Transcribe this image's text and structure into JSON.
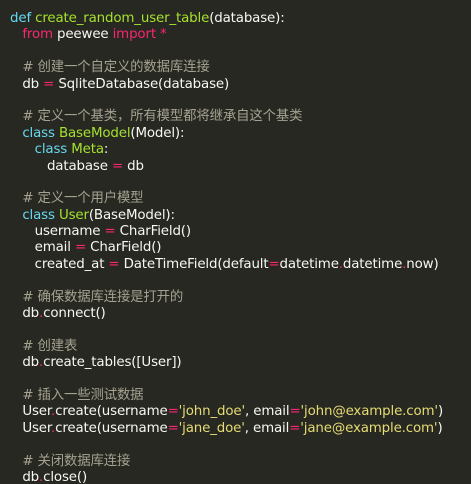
{
  "colors": {
    "background": "#272822",
    "default": "#f8f8f2",
    "keyword": "#66d9ef",
    "keyword_import": "#f92672",
    "function": "#a6e22e",
    "operator": "#f92672",
    "string": "#e6db74",
    "comment": "#a5a290"
  },
  "lines": [
    [
      [
        "def",
        "keyword"
      ],
      [
        " ",
        "default"
      ],
      [
        "create_random_user_table",
        "function"
      ],
      [
        "(database):",
        "default"
      ]
    ],
    [
      [
        "   ",
        "default"
      ],
      [
        "from",
        "keyword_import"
      ],
      [
        " peewee ",
        "default"
      ],
      [
        "import",
        "keyword_import"
      ],
      [
        " ",
        "default"
      ],
      [
        "*",
        "operator"
      ]
    ],
    [],
    [
      [
        "   # 创建一个自定义的数据库连接",
        "comment"
      ]
    ],
    [
      [
        "   db ",
        "default"
      ],
      [
        "=",
        "operator"
      ],
      [
        " SqliteDatabase(database)",
        "default"
      ]
    ],
    [],
    [
      [
        "   # 定义一个基类，所有模型都将继承自这个基类",
        "comment"
      ]
    ],
    [
      [
        "   ",
        "default"
      ],
      [
        "class",
        "keyword"
      ],
      [
        " ",
        "default"
      ],
      [
        "BaseModel",
        "function"
      ],
      [
        "(Model):",
        "default"
      ]
    ],
    [
      [
        "      ",
        "default"
      ],
      [
        "class",
        "keyword"
      ],
      [
        " ",
        "default"
      ],
      [
        "Meta",
        "function"
      ],
      [
        ":",
        "default"
      ]
    ],
    [
      [
        "         database ",
        "default"
      ],
      [
        "=",
        "operator"
      ],
      [
        " db",
        "default"
      ]
    ],
    [],
    [
      [
        "   # 定义一个用户模型",
        "comment"
      ]
    ],
    [
      [
        "   ",
        "default"
      ],
      [
        "class",
        "keyword"
      ],
      [
        " ",
        "default"
      ],
      [
        "User",
        "function"
      ],
      [
        "(BaseModel):",
        "default"
      ]
    ],
    [
      [
        "      username ",
        "default"
      ],
      [
        "=",
        "operator"
      ],
      [
        " CharField()",
        "default"
      ]
    ],
    [
      [
        "      email ",
        "default"
      ],
      [
        "=",
        "operator"
      ],
      [
        " CharField()",
        "default"
      ]
    ],
    [
      [
        "      created_at ",
        "default"
      ],
      [
        "=",
        "operator"
      ],
      [
        " DateTimeField(default",
        "default"
      ],
      [
        "=",
        "operator"
      ],
      [
        "datetime",
        "default"
      ],
      [
        ".",
        "operator"
      ],
      [
        "datetime",
        "default"
      ],
      [
        ".",
        "operator"
      ],
      [
        "now)",
        "default"
      ]
    ],
    [],
    [
      [
        "   # 确保数据库连接是打开的",
        "comment"
      ]
    ],
    [
      [
        "   db",
        "default"
      ],
      [
        ".",
        "operator"
      ],
      [
        "connect()",
        "default"
      ]
    ],
    [],
    [
      [
        "   # 创建表",
        "comment"
      ]
    ],
    [
      [
        "   db",
        "default"
      ],
      [
        ".",
        "operator"
      ],
      [
        "create_tables([User])",
        "default"
      ]
    ],
    [],
    [
      [
        "   # 插入一些测试数据",
        "comment"
      ]
    ],
    [
      [
        "   User",
        "default"
      ],
      [
        ".",
        "operator"
      ],
      [
        "create(username",
        "default"
      ],
      [
        "=",
        "operator"
      ],
      [
        "'john_doe'",
        "string"
      ],
      [
        ", email",
        "default"
      ],
      [
        "=",
        "operator"
      ],
      [
        "'john@example.com'",
        "string"
      ],
      [
        ")",
        "default"
      ]
    ],
    [
      [
        "   User",
        "default"
      ],
      [
        ".",
        "operator"
      ],
      [
        "create(username",
        "default"
      ],
      [
        "=",
        "operator"
      ],
      [
        "'jane_doe'",
        "string"
      ],
      [
        ", email",
        "default"
      ],
      [
        "=",
        "operator"
      ],
      [
        "'jane@example.com'",
        "string"
      ],
      [
        ")",
        "default"
      ]
    ],
    [],
    [
      [
        "   # 关闭数据库连接",
        "comment"
      ]
    ],
    [
      [
        "   db",
        "default"
      ],
      [
        ".",
        "operator"
      ],
      [
        "close()",
        "default"
      ]
    ]
  ]
}
